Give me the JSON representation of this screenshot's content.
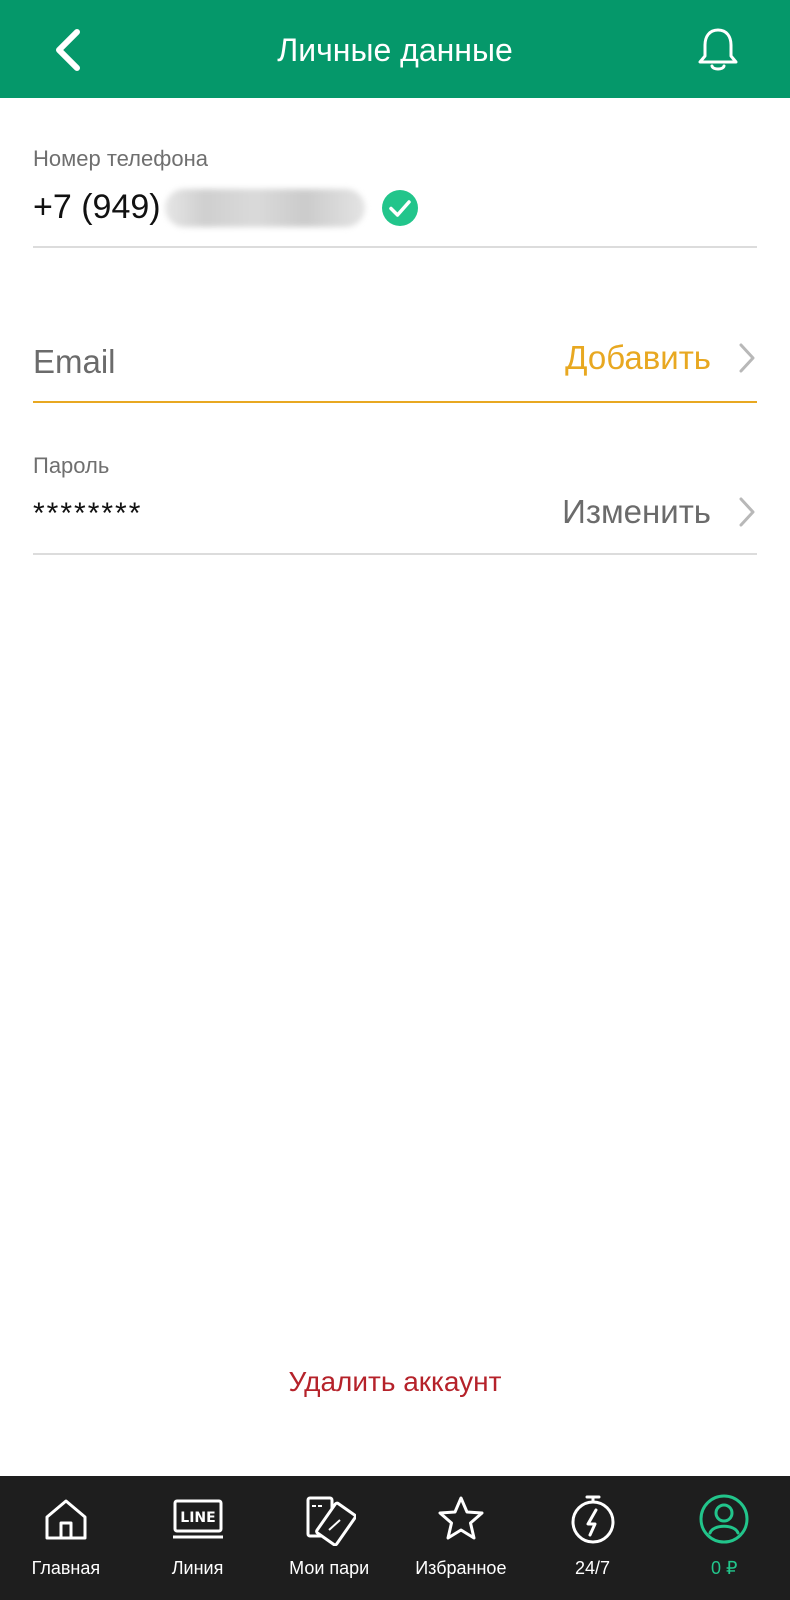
{
  "header": {
    "title": "Личные данные"
  },
  "phone": {
    "label": "Номер телефона",
    "value_prefix": "+7 (949)"
  },
  "email": {
    "placeholder": "Email",
    "action_label": "Добавить"
  },
  "password": {
    "label": "Пароль",
    "value": "********",
    "action_label": "Изменить"
  },
  "delete_account_label": "Удалить аккаунт",
  "bottom_nav": {
    "items": [
      {
        "label": "Главная",
        "icon": "home-icon"
      },
      {
        "label": "Линия",
        "icon": "line-icon",
        "icon_text": "LINE"
      },
      {
        "label": "Мои пари",
        "icon": "tickets-icon"
      },
      {
        "label": "Избранное",
        "icon": "star-icon"
      },
      {
        "label": "24/7",
        "icon": "stopwatch-icon"
      },
      {
        "label": "0 ₽",
        "icon": "user-icon",
        "active": true
      }
    ]
  },
  "colors": {
    "header_bg": "#05986a",
    "accent_orange": "#e8a821",
    "danger_red": "#b5222a",
    "verified_green": "#22c58b",
    "nav_bg": "#1e1e1e"
  }
}
